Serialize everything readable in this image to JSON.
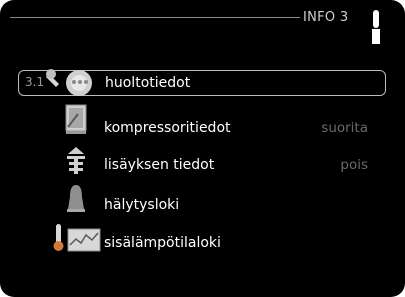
{
  "header": {
    "title": "INFO 3",
    "thermometer_icon": "thermometer-icon"
  },
  "menu": {
    "items": [
      {
        "number": "3.1",
        "label": "huoltotiedot",
        "value": "",
        "icon": "service-tools-icon",
        "selected": true
      },
      {
        "number": "",
        "label": "kompressoritiedot",
        "value": "suorita",
        "icon": "compressor-icon",
        "selected": false
      },
      {
        "number": "",
        "label": "lisäyksen tiedot",
        "value": "pois",
        "icon": "additional-heat-icon",
        "selected": false
      },
      {
        "number": "",
        "label": "hälytysloki",
        "value": "",
        "icon": "alarm-bell-icon",
        "selected": false
      },
      {
        "number": "",
        "label": "sisälämpötilaloki",
        "value": "",
        "icon": "indoor-temp-log-icon",
        "selected": false
      }
    ]
  }
}
